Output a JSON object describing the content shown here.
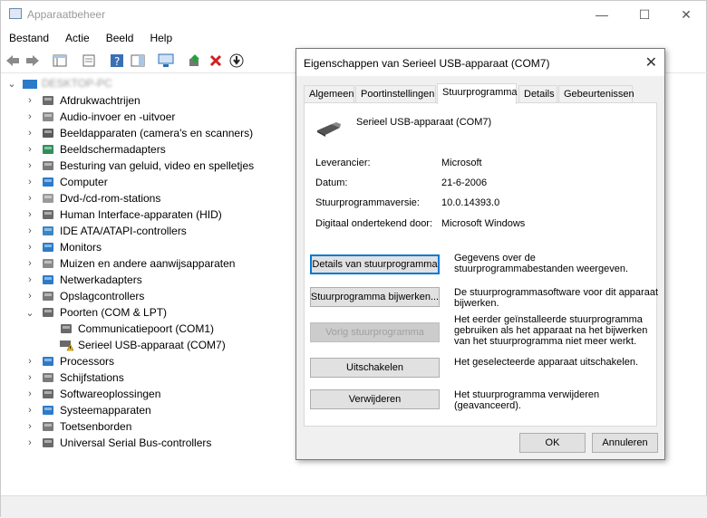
{
  "window": {
    "title": "Apparaatbeheer",
    "controls": [
      "—",
      "☐",
      "✕"
    ]
  },
  "menu": [
    "Bestand",
    "Actie",
    "Beeld",
    "Help"
  ],
  "tree": {
    "root": "DESKTOP-PC",
    "items": [
      {
        "label": "Afdrukwachtrijen",
        "icon": "printer-icon",
        "color": "#6b6b6b"
      },
      {
        "label": "Audio-invoer en -uitvoer",
        "icon": "speaker-icon",
        "color": "#8a8a8a"
      },
      {
        "label": "Beeldapparaten (camera's en scanners)",
        "icon": "camera-icon",
        "color": "#5b5b5b"
      },
      {
        "label": "Beeldschermadapters",
        "icon": "display-adapter-icon",
        "color": "#2f8f5a"
      },
      {
        "label": "Besturing van geluid, video en spelletjes",
        "icon": "sound-icon",
        "color": "#7a7a7a"
      },
      {
        "label": "Computer",
        "icon": "computer-icon",
        "color": "#2c7bc9"
      },
      {
        "label": "Dvd-/cd-rom-stations",
        "icon": "disc-icon",
        "color": "#9a9a9a"
      },
      {
        "label": "Human Interface-apparaten (HID)",
        "icon": "hid-icon",
        "color": "#6a6a6a"
      },
      {
        "label": "IDE ATA/ATAPI-controllers",
        "icon": "ide-icon",
        "color": "#3b86c4"
      },
      {
        "label": "Monitors",
        "icon": "monitor-icon",
        "color": "#2c7bc9"
      },
      {
        "label": "Muizen en andere aanwijsapparaten",
        "icon": "mouse-icon",
        "color": "#8a8a8a"
      },
      {
        "label": "Netwerkadapters",
        "icon": "network-icon",
        "color": "#2c7bc9"
      },
      {
        "label": "Opslagcontrollers",
        "icon": "storage-icon",
        "color": "#7a7a7a"
      },
      {
        "label": "Poorten (COM & LPT)",
        "icon": "port-icon",
        "color": "#6a6a6a",
        "expanded": true
      },
      {
        "label": "Communicatiepoort (COM1)",
        "icon": "com-port-icon",
        "color": "#6a6a6a",
        "child": true
      },
      {
        "label": "Serieel USB-apparaat (COM7)",
        "icon": "warning-port-icon",
        "color": "#e0a800",
        "child": true
      },
      {
        "label": "Processors",
        "icon": "processor-icon",
        "color": "#2c7bc9"
      },
      {
        "label": "Schijfstations",
        "icon": "drive-icon",
        "color": "#7a7a7a"
      },
      {
        "label": "Softwareoplossingen",
        "icon": "software-icon",
        "color": "#6a6a6a"
      },
      {
        "label": "Systeemapparaten",
        "icon": "system-icon",
        "color": "#2c7bc9"
      },
      {
        "label": "Toetsenborden",
        "icon": "keyboard-icon",
        "color": "#7a7a7a"
      },
      {
        "label": "Universal Serial Bus-controllers",
        "icon": "usb-icon",
        "color": "#6a6a6a"
      }
    ]
  },
  "dialog": {
    "title": "Eigenschappen van Serieel USB-apparaat (COM7)",
    "tabs": [
      "Algemeen",
      "Poortinstellingen",
      "Stuurprogramma",
      "Details",
      "Gebeurtenissen"
    ],
    "active_tab": "Stuurprogramma",
    "device_name": "Serieel USB-apparaat (COM7)",
    "props": [
      {
        "label": "Leverancier:",
        "value": "Microsoft"
      },
      {
        "label": "Datum:",
        "value": "21-6-2006"
      },
      {
        "label": "Stuurprogrammaversie:",
        "value": "10.0.14393.0"
      },
      {
        "label": "Digitaal ondertekend door:",
        "value": "Microsoft Windows"
      }
    ],
    "actions": [
      {
        "button": "Details van stuurprogramma",
        "desc": "Gegevens over de stuurprogrammabestanden weergeven."
      },
      {
        "button": "Stuurprogramma bijwerken...",
        "desc": "De stuurprogrammasoftware voor dit apparaat bijwerken."
      },
      {
        "button": "Vorig stuurprogramma",
        "desc": "Het eerder geïnstalleerde stuurprogramma gebruiken als het apparaat na het bijwerken van het stuurprogramma niet meer werkt."
      },
      {
        "button": "Uitschakelen",
        "desc": "Het geselecteerde apparaat uitschakelen."
      },
      {
        "button": "Verwijderen",
        "desc": "Het stuurprogramma verwijderen (geavanceerd)."
      }
    ],
    "ok": "OK",
    "cancel": "Annuleren"
  }
}
